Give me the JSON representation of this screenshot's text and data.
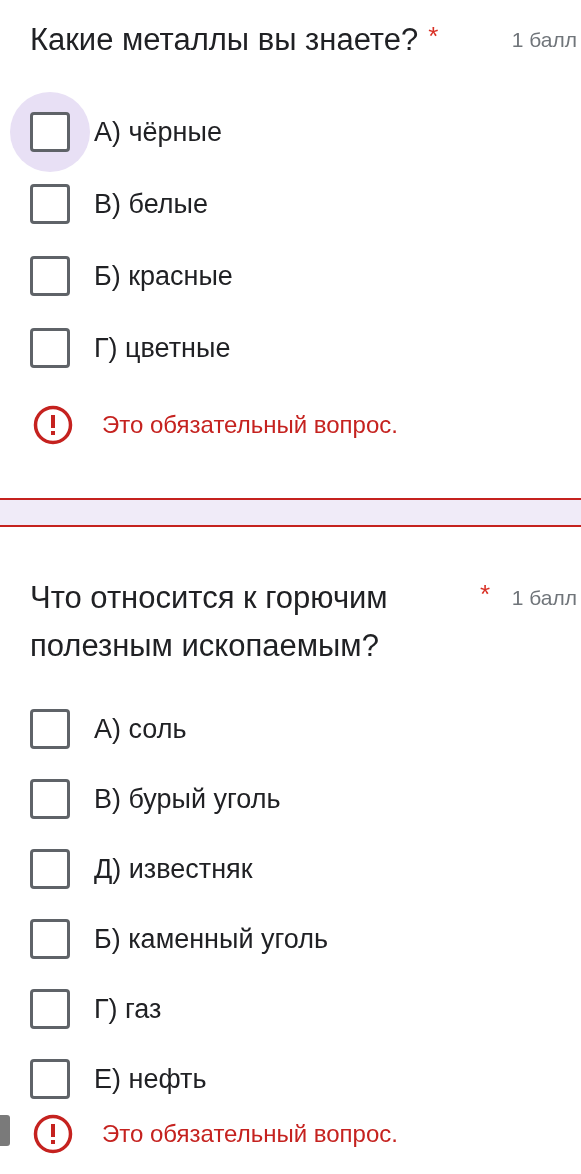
{
  "questions": [
    {
      "title": "Какие металлы вы знаете?",
      "required_mark": "*",
      "points": "1 балл",
      "options": [
        {
          "label": "А) чёрные",
          "checked": false,
          "focused": true
        },
        {
          "label": "В) белые",
          "checked": false,
          "focused": false
        },
        {
          "label": "Б) красные",
          "checked": false,
          "focused": false
        },
        {
          "label": "Г) цветные",
          "checked": false,
          "focused": false
        }
      ],
      "error": "Это обязательный вопрос."
    },
    {
      "title": "Что относится к горючим полезным ископаемым?",
      "required_mark": "*",
      "points": "1 балл",
      "options": [
        {
          "label": "А) соль",
          "checked": false,
          "focused": false
        },
        {
          "label": "В) бурый уголь",
          "checked": false,
          "focused": false
        },
        {
          "label": "Д) известняк",
          "checked": false,
          "focused": false
        },
        {
          "label": "Б) каменный уголь",
          "checked": false,
          "focused": false
        },
        {
          "label": "Г) газ",
          "checked": false,
          "focused": false
        },
        {
          "label": "Е) нефть",
          "checked": false,
          "focused": false
        }
      ],
      "error": "Это обязательный вопрос."
    }
  ]
}
